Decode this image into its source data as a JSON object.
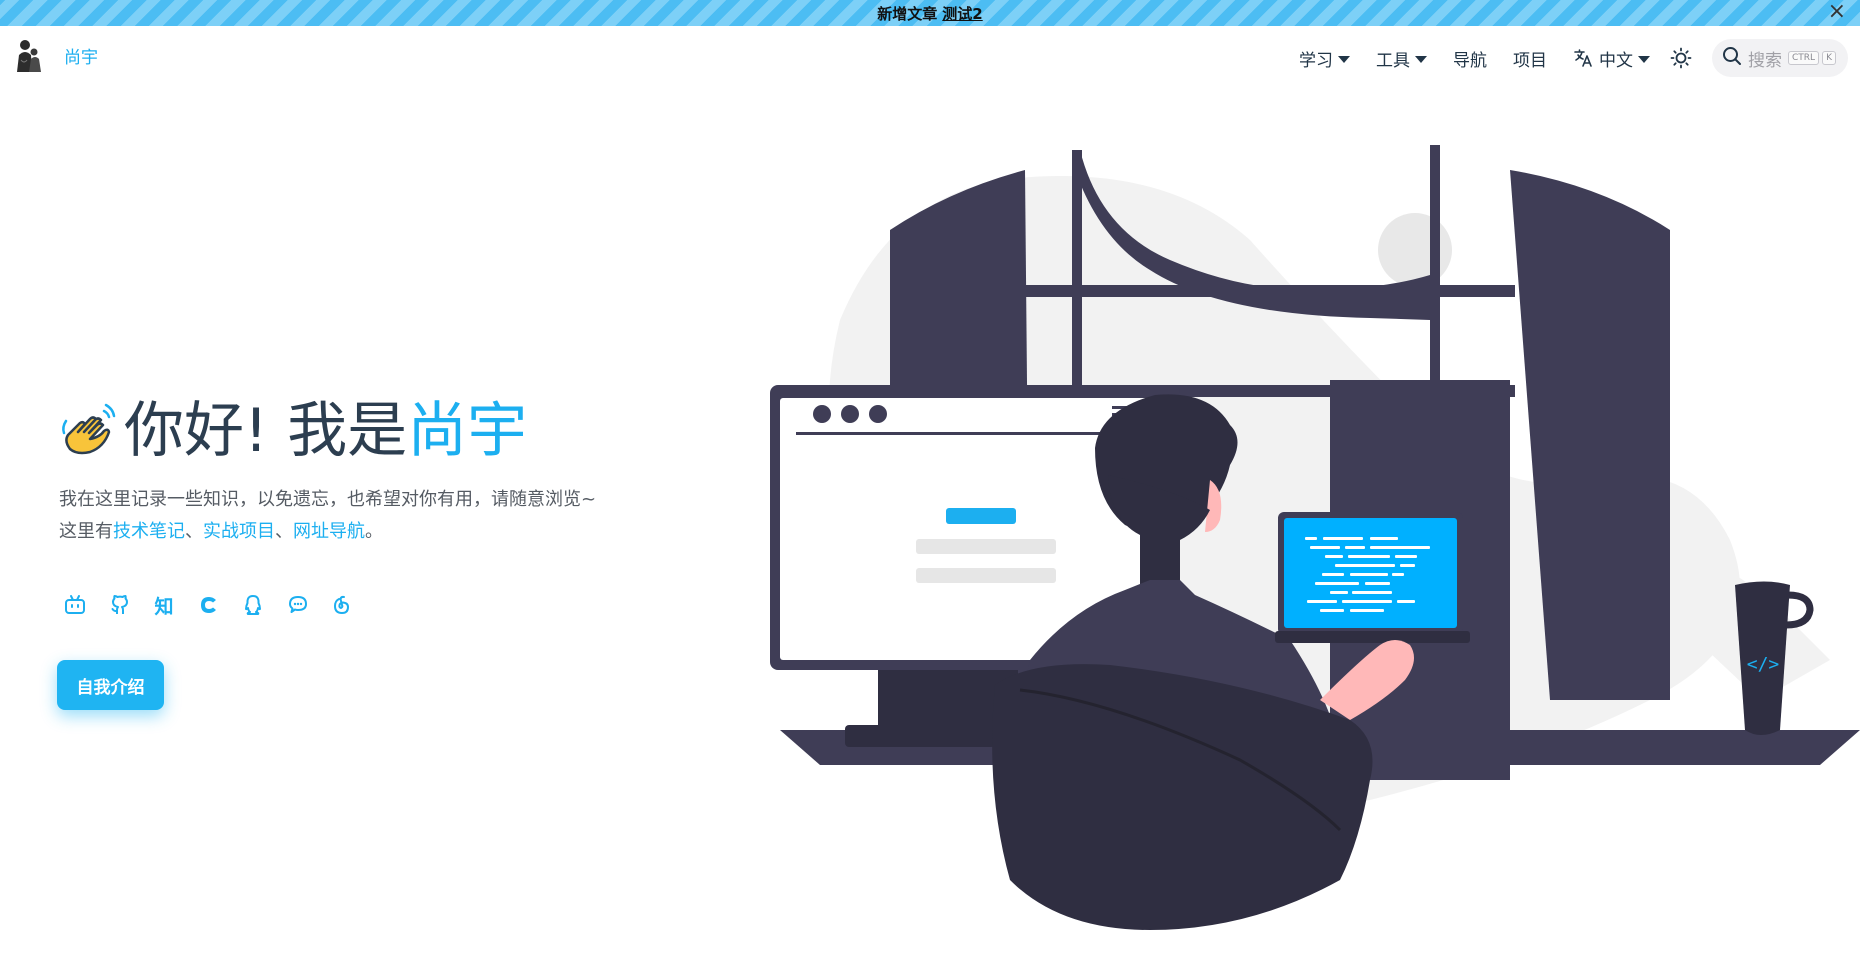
{
  "announcement": {
    "prefix": "新增文章",
    "link": "测试2",
    "close_icon": "×"
  },
  "brand": {
    "name": "尚宇",
    "avatar_icon": "avatar"
  },
  "nav": {
    "items": [
      {
        "label": "学习",
        "dropdown": true
      },
      {
        "label": "工具",
        "dropdown": true
      },
      {
        "label": "导航",
        "dropdown": false
      },
      {
        "label": "项目",
        "dropdown": false
      }
    ],
    "language": "中文",
    "theme_icon": "sun-icon",
    "search_placeholder": "搜索",
    "search_keys": [
      "CTRL",
      "K"
    ]
  },
  "hero": {
    "wave_icon": "waving-hand-icon",
    "title_prefix": "你好! 我是",
    "title_name": "尚宇",
    "desc_line1": "我在这里记录一些知识，以免遗忘，也希望对你有用，请随意浏览~",
    "desc_line2_prefix": "这里有",
    "links": [
      "技术笔记",
      "实战项目",
      "网址导航"
    ],
    "sep": "、",
    "period": "。",
    "socials": [
      "bilibili-icon",
      "github-icon",
      "zhihu-icon",
      "csdn-icon",
      "qq-icon",
      "wechat-icon",
      "netease-music-icon"
    ],
    "zhihu_text": "知",
    "button": "自我介绍"
  },
  "colors": {
    "accent": "#1caff0",
    "dark": "#3f3d56",
    "announce_stripe_a": "#7dd0f7",
    "announce_stripe_b": "#4cbdf3"
  }
}
